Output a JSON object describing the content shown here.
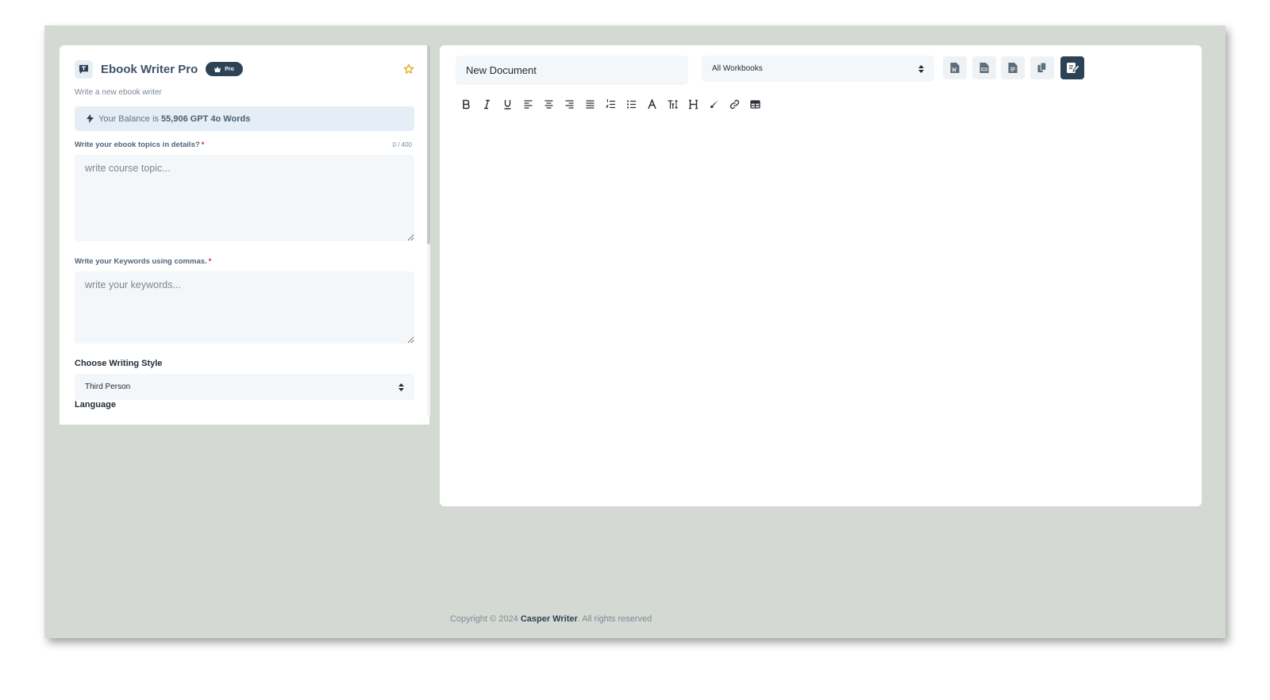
{
  "left": {
    "title": "Ebook Writer Pro",
    "badge": "Pro",
    "subtitle": "Write a new ebook writer",
    "balance": {
      "prefix": "Your Balance is",
      "amount": "55,906 GPT 4o Words"
    },
    "topics": {
      "label": "Write your ebook topics in details?",
      "required": "*",
      "counter": "0 / 400",
      "placeholder": "write course topic..."
    },
    "keywords": {
      "label": "Write your Keywords using commas.",
      "required": "*",
      "placeholder": "write your keywords..."
    },
    "style": {
      "label": "Choose Writing Style",
      "selected": "Third Person"
    },
    "language": {
      "label": "Language"
    }
  },
  "right": {
    "document_name": "New Document",
    "workbook_select": "All Workbooks",
    "actions": [
      "word-doc-icon",
      "pdf-icon",
      "txt-file-icon",
      "copy-icon",
      "save-icon"
    ],
    "toolbar": [
      "bold",
      "italic",
      "underline",
      "align-left",
      "align-center",
      "align-right",
      "align-justify",
      "ordered-list",
      "bullet-list",
      "font-color",
      "font-size",
      "heading",
      "highlight",
      "link",
      "table"
    ]
  },
  "footer": {
    "prefix": "Copyright © 2024 ",
    "brand": "Casper Writer",
    "suffix": ". All rights reserved"
  },
  "colors": {
    "accent": "#2e4256",
    "canvas": "#d4d9d4",
    "field_bg": "#f3f7fa",
    "balance_bg": "#e5eef6",
    "star": "#e8a317",
    "required": "#d9302c"
  }
}
